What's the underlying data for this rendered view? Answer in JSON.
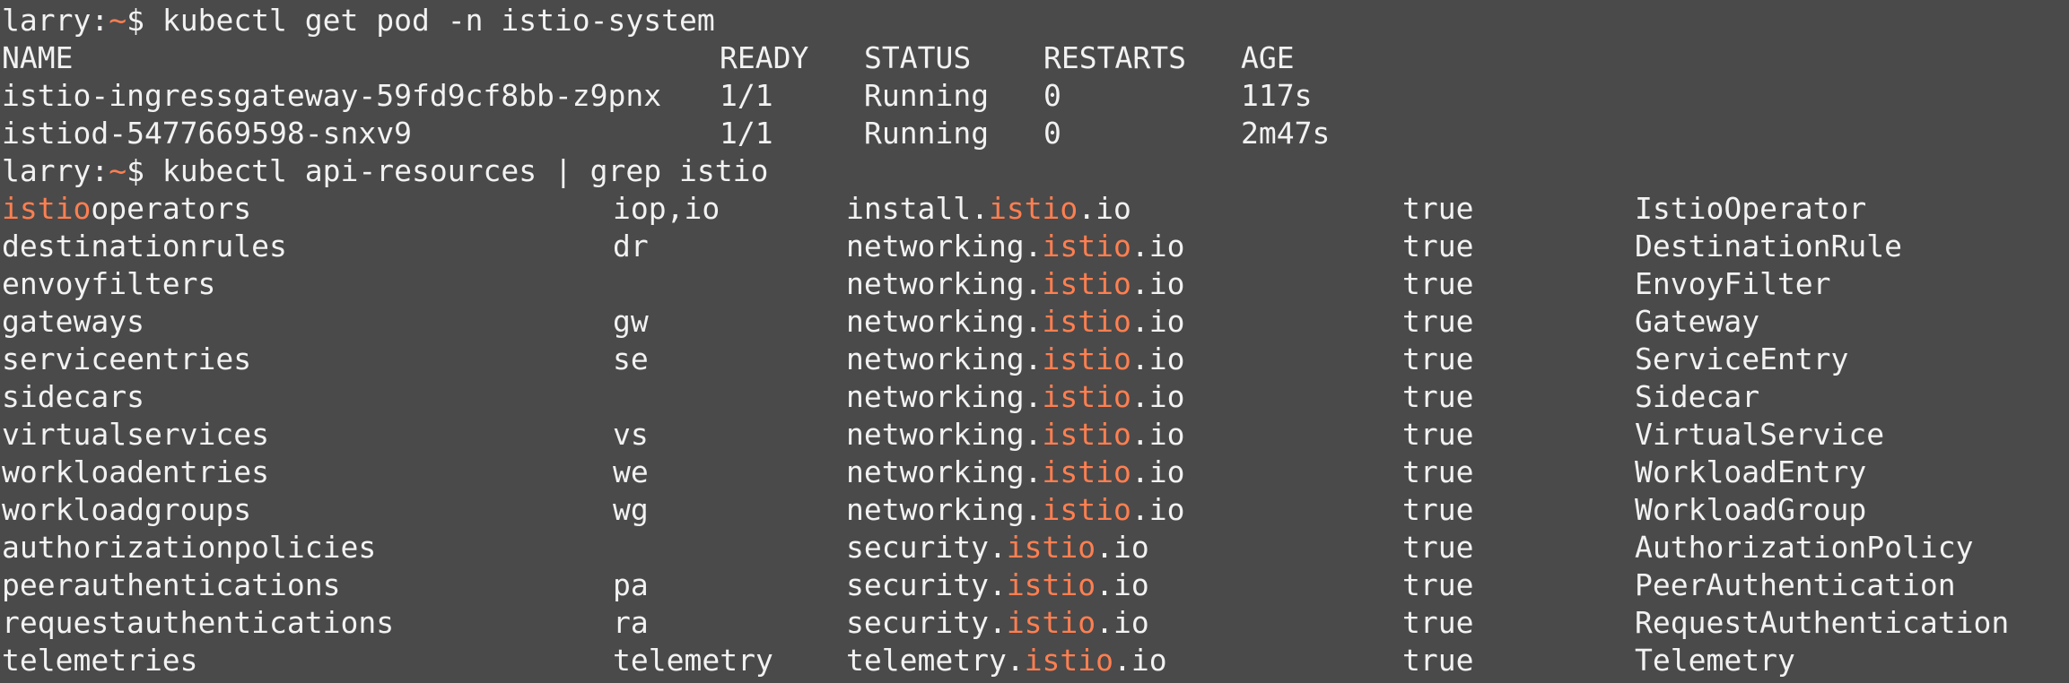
{
  "colors": {
    "background": "#4a4a4a",
    "foreground": "#f2f2f2",
    "highlight": "#ff7f50"
  },
  "prompt": {
    "user": "larry:",
    "tilde": "~",
    "symbol": "$ "
  },
  "commands": [
    "kubectl get pod -n istio-system",
    "kubectl api-resources | grep istio"
  ],
  "pods": {
    "headers": [
      "NAME",
      "READY",
      "STATUS",
      "RESTARTS",
      "AGE"
    ],
    "rows": [
      [
        "istio-ingressgateway-59fd9cf8bb-z9pnx",
        "1/1",
        "Running",
        "0",
        "117s"
      ],
      [
        "istiod-5477669598-snxv9",
        "1/1",
        "Running",
        "0",
        "2m47s"
      ]
    ]
  },
  "resources": {
    "match": "istio",
    "rows": [
      {
        "name_pre": "",
        "name_hl": "istio",
        "name_post": "operators",
        "short": "iop,io",
        "group_pre": "install.",
        "group_post": ".io",
        "namespaced": "true",
        "kind": "IstioOperator"
      },
      {
        "name_pre": "destinationrules",
        "name_hl": "",
        "name_post": "",
        "short": "dr",
        "group_pre": "networking.",
        "group_post": ".io",
        "namespaced": "true",
        "kind": "DestinationRule"
      },
      {
        "name_pre": "envoyfilters",
        "name_hl": "",
        "name_post": "",
        "short": "",
        "group_pre": "networking.",
        "group_post": ".io",
        "namespaced": "true",
        "kind": "EnvoyFilter"
      },
      {
        "name_pre": "gateways",
        "name_hl": "",
        "name_post": "",
        "short": "gw",
        "group_pre": "networking.",
        "group_post": ".io",
        "namespaced": "true",
        "kind": "Gateway"
      },
      {
        "name_pre": "serviceentries",
        "name_hl": "",
        "name_post": "",
        "short": "se",
        "group_pre": "networking.",
        "group_post": ".io",
        "namespaced": "true",
        "kind": "ServiceEntry"
      },
      {
        "name_pre": "sidecars",
        "name_hl": "",
        "name_post": "",
        "short": "",
        "group_pre": "networking.",
        "group_post": ".io",
        "namespaced": "true",
        "kind": "Sidecar"
      },
      {
        "name_pre": "virtualservices",
        "name_hl": "",
        "name_post": "",
        "short": "vs",
        "group_pre": "networking.",
        "group_post": ".io",
        "namespaced": "true",
        "kind": "VirtualService"
      },
      {
        "name_pre": "workloadentries",
        "name_hl": "",
        "name_post": "",
        "short": "we",
        "group_pre": "networking.",
        "group_post": ".io",
        "namespaced": "true",
        "kind": "WorkloadEntry"
      },
      {
        "name_pre": "workloadgroups",
        "name_hl": "",
        "name_post": "",
        "short": "wg",
        "group_pre": "networking.",
        "group_post": ".io",
        "namespaced": "true",
        "kind": "WorkloadGroup"
      },
      {
        "name_pre": "authorizationpolicies",
        "name_hl": "",
        "name_post": "",
        "short": "",
        "group_pre": "security.",
        "group_post": ".io",
        "namespaced": "true",
        "kind": "AuthorizationPolicy"
      },
      {
        "name_pre": "peerauthentications",
        "name_hl": "",
        "name_post": "",
        "short": "pa",
        "group_pre": "security.",
        "group_post": ".io",
        "namespaced": "true",
        "kind": "PeerAuthentication"
      },
      {
        "name_pre": "requestauthentications",
        "name_hl": "",
        "name_post": "",
        "short": "ra",
        "group_pre": "security.",
        "group_post": ".io",
        "namespaced": "true",
        "kind": "RequestAuthentication"
      },
      {
        "name_pre": "telemetries",
        "name_hl": "",
        "name_post": "",
        "short": "telemetry",
        "group_pre": "telemetry.",
        "group_post": ".io",
        "namespaced": "true",
        "kind": "Telemetry"
      }
    ]
  }
}
